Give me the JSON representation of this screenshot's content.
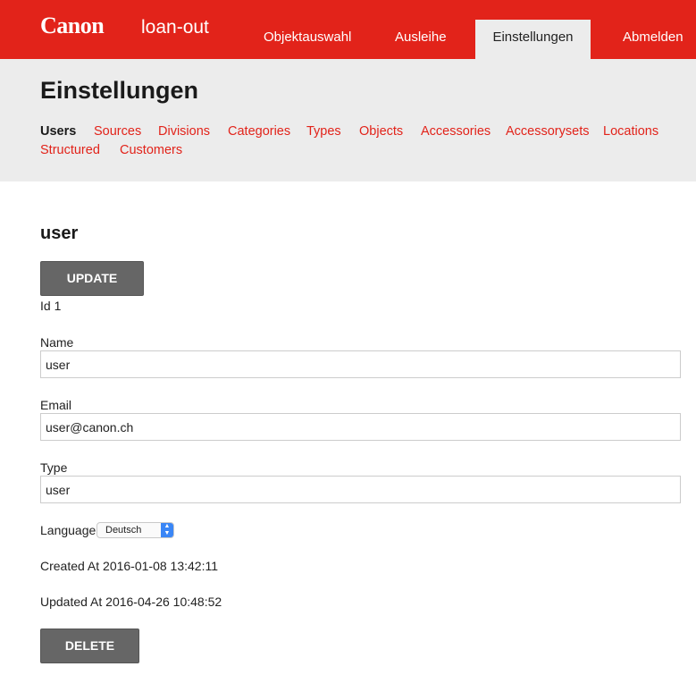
{
  "header": {
    "logo": "Canon",
    "app_name": "loan-out",
    "nav": {
      "objektauswahl": "Objektauswahl",
      "ausleihe": "Ausleihe",
      "einstellungen": "Einstellungen",
      "abmelden": "Abmelden"
    }
  },
  "settings": {
    "title": "Einstellungen",
    "tabs": {
      "users": "Users",
      "sources": "Sources",
      "divisions": "Divisions",
      "categories": "Categories",
      "types": "Types",
      "objects": "Objects",
      "accessories": "Accessories",
      "accessorysets": "Accessorysets",
      "locations": "Locations",
      "structured": "Structured",
      "customers": "Customers"
    },
    "active_tab": "Users"
  },
  "form": {
    "title": "user",
    "update_label": "UPDATE",
    "id_text": "Id 1",
    "name_label": "Name",
    "name_value": "user",
    "email_label": "Email",
    "email_value": "user@canon.ch",
    "type_label": "Type",
    "type_value": "user",
    "language_label": "Language",
    "language_value": "Deutsch",
    "created_at": "Created At 2016-01-08 13:42:11",
    "updated_at": "Updated At 2016-04-26 10:48:52",
    "delete_label": "DELETE"
  },
  "colors": {
    "brand_red": "#e2231a",
    "subheader_bg": "#ececec",
    "button_gray": "#666666",
    "select_accent": "#3a86f6"
  },
  "icons": {
    "select_arrows": "updown-chevron-icon"
  }
}
